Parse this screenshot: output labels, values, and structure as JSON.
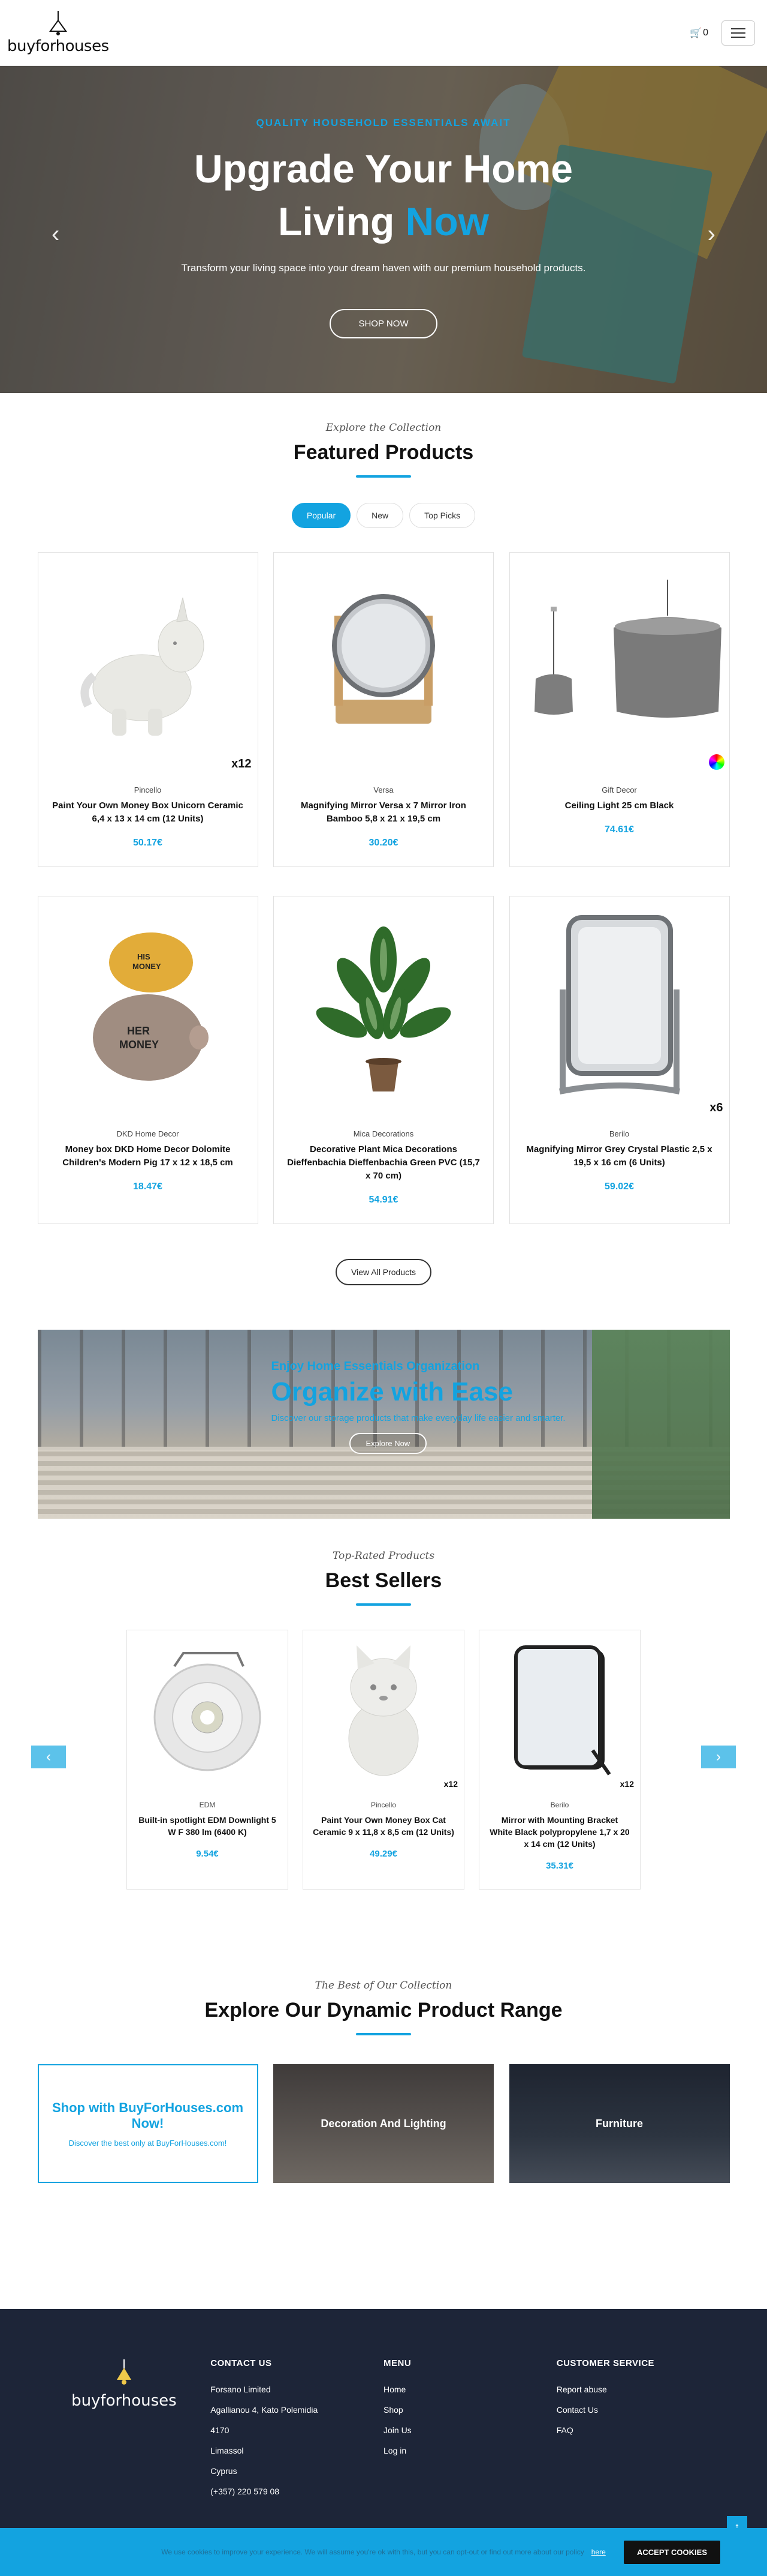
{
  "header": {
    "logo_text": "buyforhouses",
    "cart_count": "0"
  },
  "hero": {
    "kicker": "QUALITY HOUSEHOLD ESSENTIALS AWAIT",
    "title_line1": "Upgrade Your Home",
    "title_line2_prefix": "Living ",
    "title_line2_accent": "Now",
    "subtitle": "Transform your living space into your dream haven with our premium household products.",
    "cta": "SHOP NOW"
  },
  "featured": {
    "kicker": "Explore the Collection",
    "title": "Featured Products",
    "tabs": [
      "Popular",
      "New",
      "Top Picks"
    ],
    "products": [
      {
        "brand": "Pincello",
        "name": "Paint Your Own Money Box Unicorn Ceramic 6,4 x 13 x 14 cm (12 Units)",
        "price": "50.17€",
        "badge": "x12"
      },
      {
        "brand": "Versa",
        "name": "Magnifying Mirror Versa x 7 Mirror Iron Bamboo 5,8 x 21 x 19,5 cm",
        "price": "30.20€",
        "badge": ""
      },
      {
        "brand": "Gift Decor",
        "name": "Ceiling Light 25 cm Black",
        "price": "74.61€",
        "badge": ""
      },
      {
        "brand": "DKD Home Decor",
        "name": "Money box DKD Home Decor Dolomite Children's Modern Pig 17 x 12 x 18,5 cm",
        "price": "18.47€",
        "badge": ""
      },
      {
        "brand": "Mica Decorations",
        "name": "Decorative Plant Mica Decorations Dieffenbachia Dieffenbachia Green PVC (15,7 x 70 cm)",
        "price": "54.91€",
        "badge": ""
      },
      {
        "brand": "Berilo",
        "name": "Magnifying Mirror Grey Crystal Plastic 2,5 x 19,5 x 16 cm (6 Units)",
        "price": "59.02€",
        "badge": "x6"
      }
    ],
    "view_all": "View All Products"
  },
  "banner": {
    "kicker": "Enjoy Home Essentials Organization",
    "title": "Organize with Ease",
    "subtitle": "Discover our storage products that make everyday life easier and smarter.",
    "cta": "Explore Now"
  },
  "bestsellers": {
    "kicker": "Top-Rated Products",
    "title": "Best Sellers",
    "products": [
      {
        "brand": "EDM",
        "name": "Built-in spotlight EDM Downlight 5 W F 380 lm (6400 K)",
        "price": "9.54€",
        "badge": ""
      },
      {
        "brand": "Pincello",
        "name": "Paint Your Own Money Box Cat Ceramic 9 x 11,8 x 8,5 cm (12 Units)",
        "price": "49.29€",
        "badge": "x12"
      },
      {
        "brand": "Berilo",
        "name": "Mirror with Mounting Bracket White Black polypropylene 1,7 x 20 x 14 cm (12 Units)",
        "price": "35.31€",
        "badge": "x12"
      }
    ]
  },
  "dynamic": {
    "kicker": "The Best of Our Collection",
    "title": "Explore Our Dynamic Product Range",
    "promo_title": "Shop with BuyForHouses.com Now!",
    "promo_sub": "Discover the best only at BuyForHouses.com!",
    "cat1": "Decoration And Lighting",
    "cat2": "Furniture"
  },
  "footer": {
    "logo_text": "buyforhouses",
    "contact_title": "CONTACT US",
    "contact": [
      "Forsano Limited",
      "Agallianou 4, Kato Polemidia",
      "4170",
      "Limassol",
      "Cyprus",
      "(+357) 220 579 08"
    ],
    "menu_title": "MENU",
    "menu": [
      "Home",
      "Shop",
      "Join Us",
      "Log in"
    ],
    "service_title": "CUSTOMER SERVICE",
    "service": [
      "Report abuse",
      "Contact Us",
      "FAQ"
    ]
  },
  "cookie": {
    "message": "We use cookies to improve your experience. We will assume you're ok with this, but you can opt-out or find out more about our policy",
    "link": "here",
    "accept": "ACCEPT COOKIES"
  },
  "colors": {
    "accent": "#13a3e0",
    "footer_bg": "#1d2538"
  }
}
